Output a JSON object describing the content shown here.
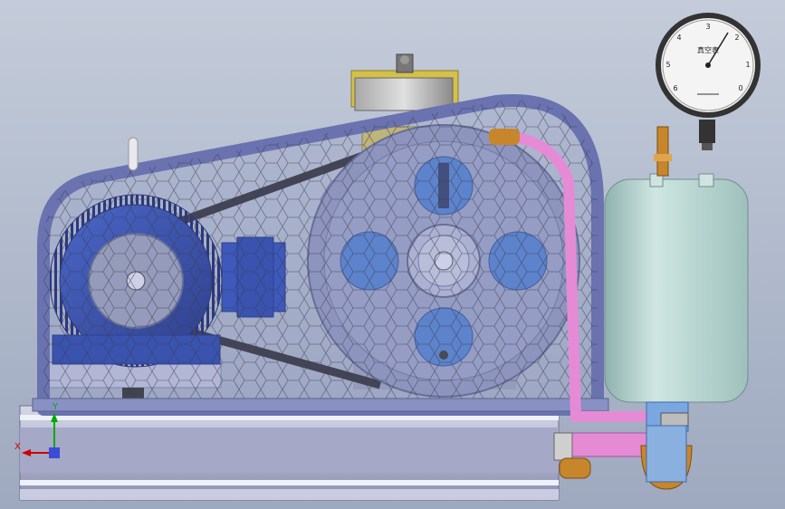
{
  "scene": {
    "subject": "belt-driven vacuum pump assembly CAD render",
    "colors": {
      "background_top": "#c4ccda",
      "background_bottom": "#9ea9bf",
      "motor": "#1f3fa8",
      "motor_dark": "#13267a",
      "guard": "#8890c4",
      "guard_frame": "#6a72b0",
      "flywheel": "#8f97bc",
      "flywheel_dark": "#6c7499",
      "hole": "#4f7fcf",
      "tank": "#b7d7d3",
      "tank_dark": "#8fb2ae",
      "base": "#b4b6cf",
      "pipe": "#e58bd6",
      "brass": "#c8862c"
    }
  },
  "gauge": {
    "label": "真空表",
    "ticks": [
      "0",
      "1",
      "2",
      "3",
      "4",
      "5",
      "6"
    ]
  },
  "triad": {
    "x_label": "X",
    "y_label": "Y"
  }
}
